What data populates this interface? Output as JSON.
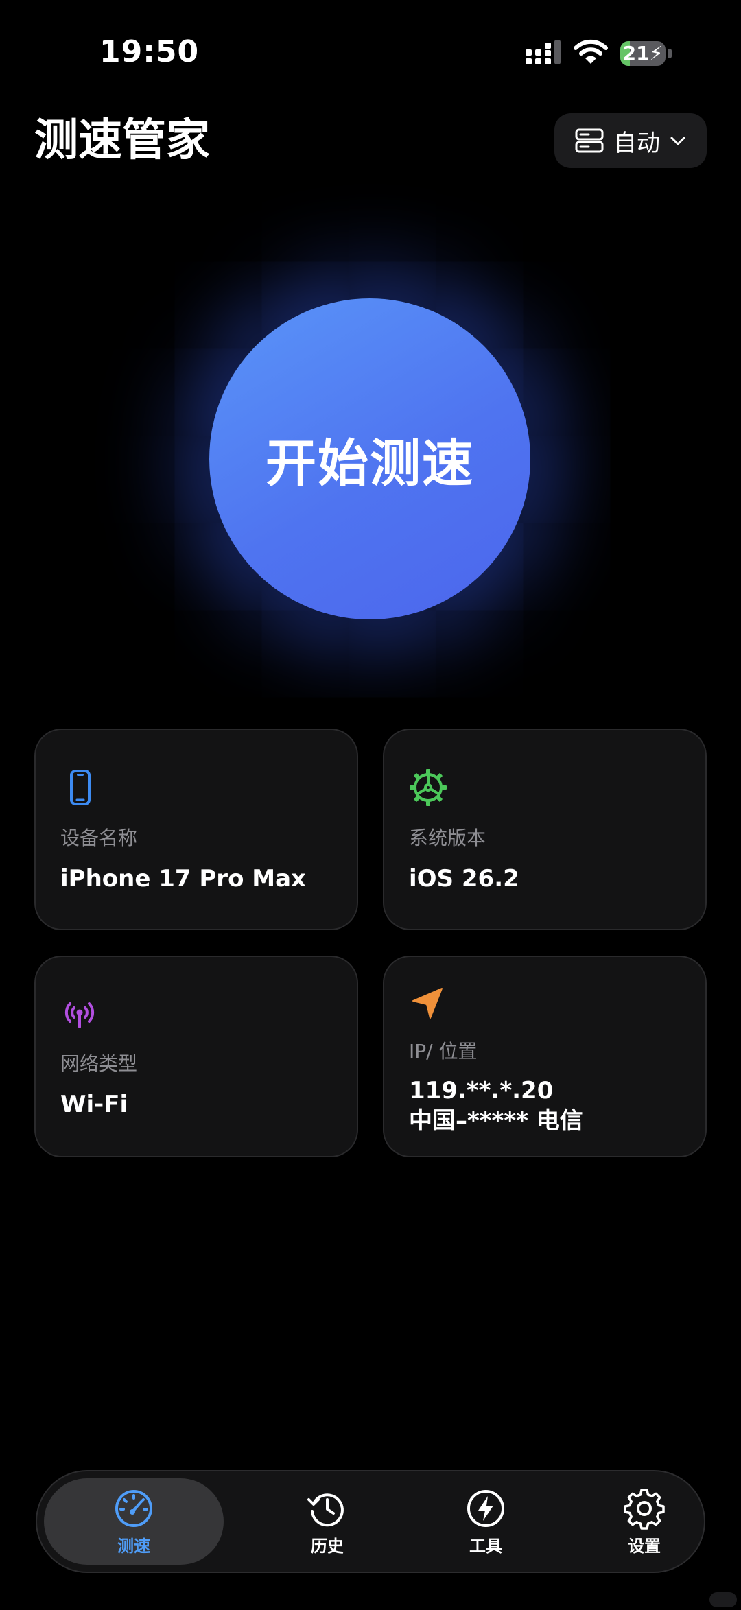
{
  "status_bar": {
    "time": "19:50",
    "battery_level": "21",
    "battery_fraction": 0.21,
    "battery_color": "#65c466"
  },
  "header": {
    "title": "测速管家",
    "server_select": {
      "icon": "server-icon",
      "label": "自动"
    }
  },
  "start_button": {
    "label": "开始测速",
    "gradient": [
      "#5a95f8",
      "#4c66ec"
    ]
  },
  "info_cards": {
    "device": {
      "icon": "iphone-icon",
      "icon_color": "#3d8bf2",
      "label": "设备名称",
      "value": "iPhone 17 Pro Max"
    },
    "os": {
      "icon": "gear-steering-icon",
      "icon_color": "#4cc85a",
      "label": "系统版本",
      "value": "iOS 26.2"
    },
    "network": {
      "icon": "antenna-icon",
      "icon_color": "#b24fe0",
      "label": "网络类型",
      "value": "Wi-Fi"
    },
    "ip": {
      "icon": "location-arrow-icon",
      "icon_color": "#f0913a",
      "label": "IP/ 位置",
      "ip": "119.**.*.20",
      "location": "中国–***** 电信"
    }
  },
  "tab_bar": {
    "active_color": "#4f9df8",
    "tabs": [
      {
        "label": "测速",
        "icon": "speedometer-icon",
        "active": true
      },
      {
        "label": "历史",
        "icon": "history-icon",
        "active": false
      },
      {
        "label": "工具",
        "icon": "bolt-icon",
        "active": false
      },
      {
        "label": "设置",
        "icon": "gear-icon",
        "active": false
      }
    ]
  }
}
